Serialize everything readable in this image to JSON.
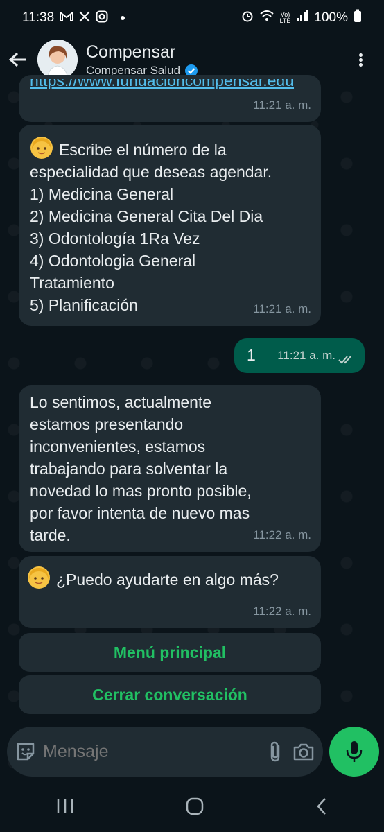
{
  "status_bar": {
    "time": "11:38",
    "battery": "100%",
    "icons": [
      "gmail-icon",
      "x-icon",
      "instagram-icon",
      "dot-icon",
      "alarm-icon",
      "wifi-icon",
      "volte-icon",
      "signal-icon",
      "battery-icon"
    ]
  },
  "header": {
    "title": "Compensar",
    "subtitle": "Compensar Salud",
    "verified": true
  },
  "messages": [
    {
      "id": "m0",
      "type": "incoming",
      "text": "https://www.fundacioncompensar.edu",
      "time": "11:21 a. m."
    },
    {
      "id": "m1",
      "type": "incoming",
      "emoji": "woman-emoji",
      "lines": [
        "Escribe el número de la",
        "especialidad que deseas agendar.",
        "1) Medicina General",
        "2) Medicina General Cita Del Dia",
        "3) Odontología 1Ra Vez",
        "4) Odontologia General",
        "Tratamiento",
        "5) Planificación"
      ],
      "time": "11:21 a. m."
    },
    {
      "id": "m2",
      "type": "outgoing",
      "text": "1",
      "time": "11:21 a. m.",
      "ticks": "read"
    },
    {
      "id": "m3",
      "type": "incoming",
      "lines": [
        "Lo sentimos, actualmente",
        "estamos presentando",
        "inconvenientes, estamos",
        "trabajando para solventar la",
        "novedad lo mas pronto posible,",
        "por favor intenta de nuevo mas",
        "tarde."
      ],
      "time": "11:22 a. m."
    },
    {
      "id": "m4",
      "type": "incoming",
      "emoji": "woman-emoji",
      "text": "¿Puedo ayudarte en algo más?",
      "time": "11:22 a. m."
    }
  ],
  "quick_replies": [
    "Menú principal",
    "Cerrar conversación"
  ],
  "composer": {
    "placeholder": "Mensaje"
  },
  "colors": {
    "background": "#0b141a",
    "bubble_in": "#202c33",
    "bubble_out": "#005c4b",
    "accent": "#21c063"
  }
}
